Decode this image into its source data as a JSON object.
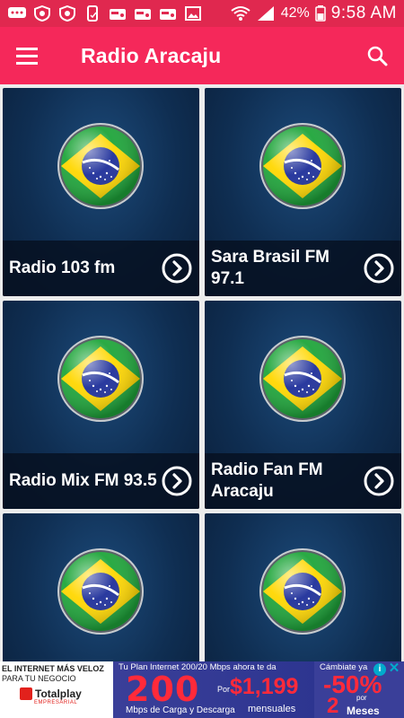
{
  "status_bar": {
    "battery": "42%",
    "time": "9:58 AM"
  },
  "app_bar": {
    "title": "Radio Aracaju",
    "menu_icon": "hamburger-menu-icon",
    "search_icon": "search-icon"
  },
  "stations": [
    {
      "name": "Radio 103 fm"
    },
    {
      "name": "Sara Brasil FM 97.1"
    },
    {
      "name": "Radio Mix FM 93.5"
    },
    {
      "name": "Radio Fan FM Aracaju"
    },
    {
      "name": ""
    },
    {
      "name": ""
    }
  ],
  "ad": {
    "left_line1": "EL INTERNET MÁS VELOZ",
    "left_line2": "PARA TU NEGOCIO",
    "brand": "Totalplay",
    "brand_sub": "EMPRESARIAL",
    "mid_top": "Tu Plan Internet 200/20 Mbps ahora te da",
    "speed": "200",
    "por": "Por",
    "price": "$1,199",
    "mid_bottom": "Mbps de Carga y Descarga",
    "mensuales": "mensuales",
    "right_top": "Cámbiate ya",
    "discount": "-50%",
    "por2": "por",
    "months_num": "2",
    "months": "Meses",
    "info": "i",
    "close": "✕"
  },
  "colors": {
    "status_bar": "#e0284f",
    "app_bar": "#f5285a",
    "card_bg": "#0f2e52"
  }
}
